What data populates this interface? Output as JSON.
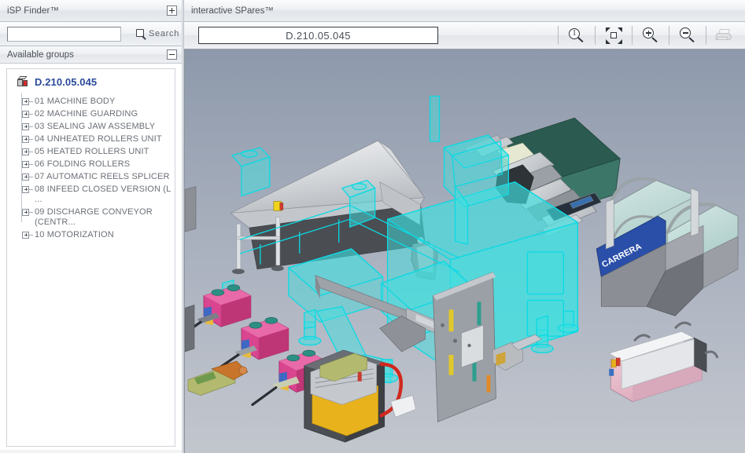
{
  "left_panel": {
    "title": "iSP Finder™",
    "expand_button": "+",
    "search": {
      "value": "",
      "placeholder": "",
      "button_label": "Search",
      "icon": "magnifier-icon"
    },
    "groups_header": {
      "title": "Available groups",
      "collapse_button": "−"
    },
    "tree": {
      "root": {
        "label": "D.210.05.045",
        "icon": "cube-icon"
      },
      "items": [
        {
          "label": "01 MACHINE BODY",
          "expander": "+"
        },
        {
          "label": "02 MACHINE GUARDING",
          "expander": "+"
        },
        {
          "label": "03 SEALING JAW ASSEMBLY",
          "expander": "+"
        },
        {
          "label": "04 UNHEATED ROLLERS UNIT",
          "expander": "+"
        },
        {
          "label": "05 HEATED ROLLERS UNIT",
          "expander": "+"
        },
        {
          "label": "06 FOLDING ROLLERS",
          "expander": "+"
        },
        {
          "label": "07 AUTOMATIC REELS SPLICER",
          "expander": "+"
        },
        {
          "label": "08 INFEED CLOSED VERSION (L ...",
          "expander": "+"
        },
        {
          "label": "09 DISCHARGE CONVEYOR\n(CENTR...",
          "expander": "+"
        },
        {
          "label": "10 MOTORIZATION",
          "expander": "+"
        }
      ]
    }
  },
  "right_panel": {
    "title": "interactive SPares™",
    "part_code": "D.210.05.045",
    "toolbar": [
      {
        "name": "zoom-one-to-one-button",
        "icon": "zoom-1to1-icon",
        "enabled": true
      },
      {
        "name": "fit-to-window-button",
        "icon": "fit-to-window-icon",
        "enabled": true
      },
      {
        "name": "zoom-in-button",
        "icon": "zoom-in-icon",
        "enabled": true
      },
      {
        "name": "zoom-out-button",
        "icon": "zoom-out-icon",
        "enabled": true
      },
      {
        "name": "print-button",
        "icon": "printer-icon",
        "enabled": false
      }
    ],
    "viewport": {
      "label_carrera": "CARRERA",
      "highlight_color": "#3fe0e0",
      "background_top": "#8d99ab",
      "background_bottom": "#c2c6cd"
    }
  }
}
